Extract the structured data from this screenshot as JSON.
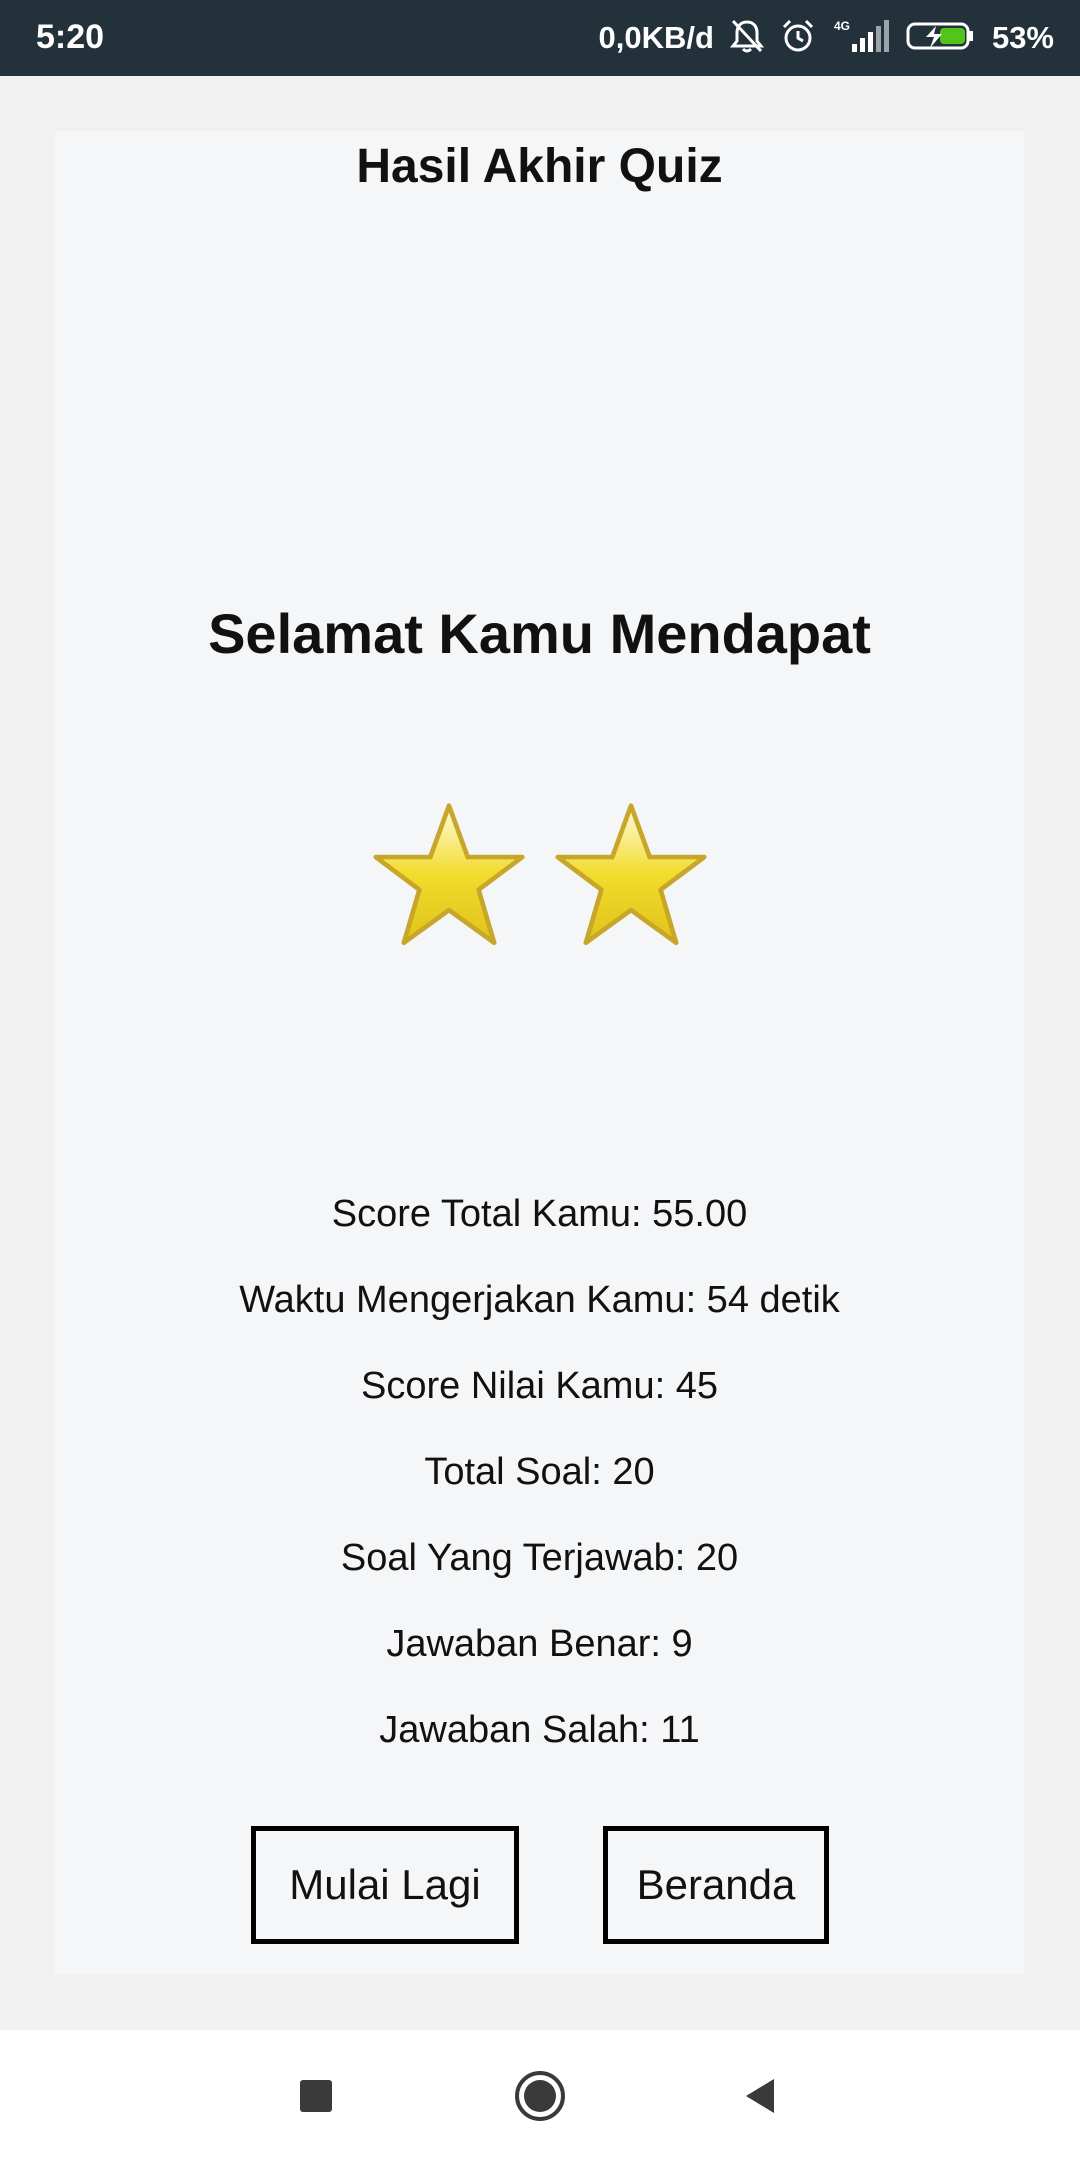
{
  "status_bar": {
    "time": "5:20",
    "network_speed": "0,0KB/d",
    "network_type": "4G",
    "battery_percent": "53%",
    "icons": [
      "bell-muted-icon",
      "alarm-icon",
      "signal-icon",
      "battery-charging-icon"
    ]
  },
  "quiz_result": {
    "title": "Hasil Akhir Quiz",
    "congrats_text": "Selamat Kamu Mendapat",
    "stars_earned": 2,
    "stats": [
      "Score Total Kamu: 55.00",
      "Waktu Mengerjakan Kamu: 54 detik",
      "Score Nilai Kamu: 45",
      "Total Soal: 20",
      "Soal Yang Terjawab: 20",
      "Jawaban Benar: 9",
      "Jawaban Salah: 11"
    ],
    "buttons": {
      "restart": "Mulai Lagi",
      "home": "Beranda"
    }
  },
  "nav_bar": {
    "icons": [
      "recent-apps-icon",
      "home-icon",
      "back-icon"
    ]
  },
  "colors": {
    "status_bar_bg": "#22313a",
    "page_bg": "#f1f1f1",
    "card_bg": "#f5f6f8",
    "star_fill": "#f2dc2c",
    "star_outline": "#c8a62a"
  }
}
